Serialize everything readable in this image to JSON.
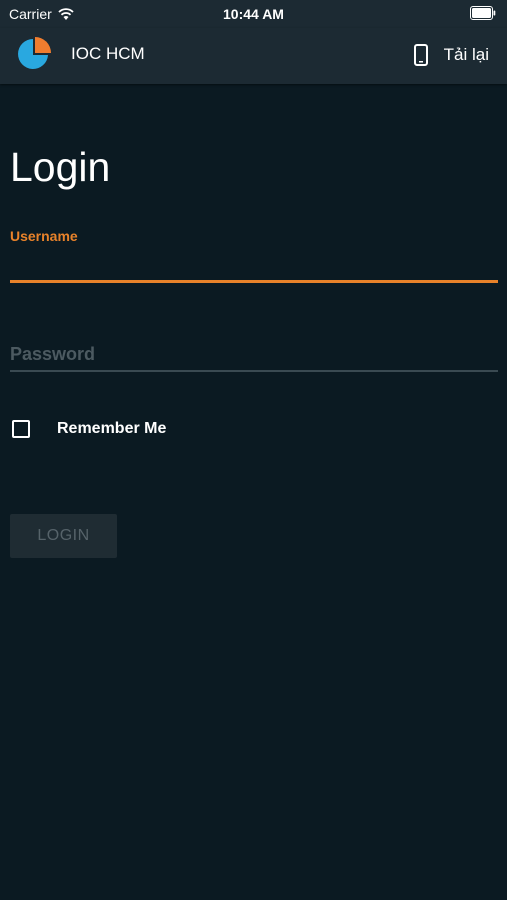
{
  "status_bar": {
    "carrier": "Carrier",
    "time": "10:44 AM"
  },
  "nav": {
    "title": "IOC HCM",
    "reload_label": "Tải lại"
  },
  "login": {
    "title": "Login",
    "username_label": "Username",
    "username_value": "",
    "password_placeholder": "Password",
    "remember_label": "Remember Me",
    "remember_checked": false,
    "login_button": "LOGIN"
  },
  "colors": {
    "background": "#0b1a22",
    "bar": "#1c2a33",
    "accent": "#e8822a",
    "logo_blue": "#29a8e0",
    "logo_orange": "#f07d2f"
  }
}
